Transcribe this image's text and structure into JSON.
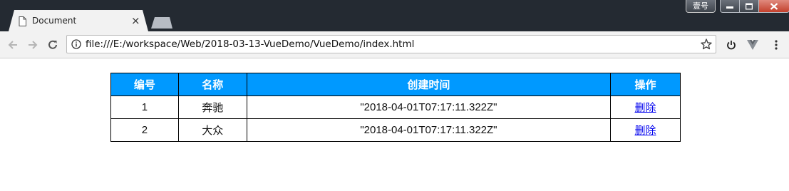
{
  "browser": {
    "tab_title": "Document",
    "tab_close_glyph": "×",
    "user_badge": "壹号",
    "url": "file:///E:/workspace/Web/2018-03-13-VueDemo/VueDemo/index.html"
  },
  "table": {
    "headers": [
      "编号",
      "名称",
      "创建时间",
      "操作"
    ],
    "rows": [
      {
        "id": "1",
        "name": "奔驰",
        "ctime": "\"2018-04-01T07:17:11.322Z\"",
        "action": "删除"
      },
      {
        "id": "2",
        "name": "大众",
        "ctime": "\"2018-04-01T07:17:11.322Z\"",
        "action": "删除"
      }
    ]
  },
  "colors": {
    "header_bg": "#0099ff",
    "header_text": "#ffffff",
    "link": "#0000ee",
    "chrome_frame": "#242a32"
  },
  "icons": {
    "tab": "document-icon",
    "back": "arrow-left-icon",
    "forward": "arrow-right-icon",
    "reload": "reload-icon",
    "site_info": "info-icon",
    "bookmark": "star-icon",
    "extension_1": "power-icon",
    "extension_2": "vue-devtools-icon",
    "menu": "more-vertical-icon"
  }
}
